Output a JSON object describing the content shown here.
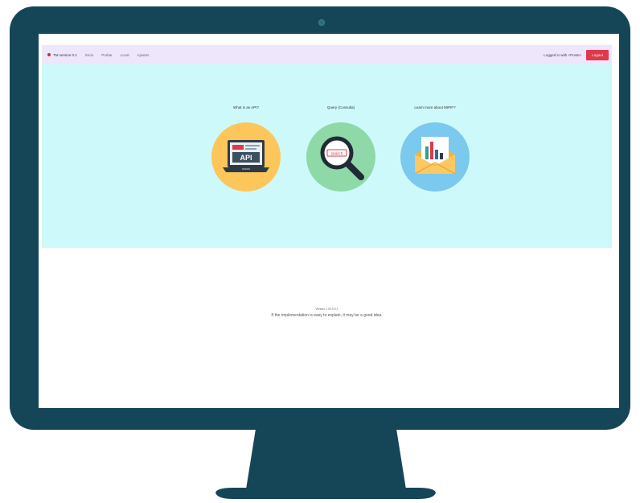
{
  "nav": {
    "brand": "TM version 0.1",
    "links": [
      "Inicio",
      "Probar",
      "Local",
      "Ajustes"
    ],
    "user": "Logged in with <Poste>",
    "button": "Logout"
  },
  "features": [
    {
      "title": "What is an API?",
      "icon": "laptop-api-icon",
      "circle_color": "#fdc65b",
      "icon_text": "API"
    },
    {
      "title": "Query (Consulta)",
      "icon": "magnifier-icon",
      "circle_color": "#8fd9a8",
      "icon_text": "search"
    },
    {
      "title": "Learn more about MIPIF?",
      "icon": "mail-chart-icon",
      "circle_color": "#7bc9ee",
      "icon_text": ""
    }
  ],
  "footer": {
    "small": "Versión 1.00.0.0.1",
    "text": "If the implementation is easy to explain, it may be a good idea."
  },
  "colors": {
    "bezel": "#154657",
    "hero_bg": "#cef9fb",
    "navbar_bg": "#eee6fb",
    "accent": "#e0384d"
  }
}
